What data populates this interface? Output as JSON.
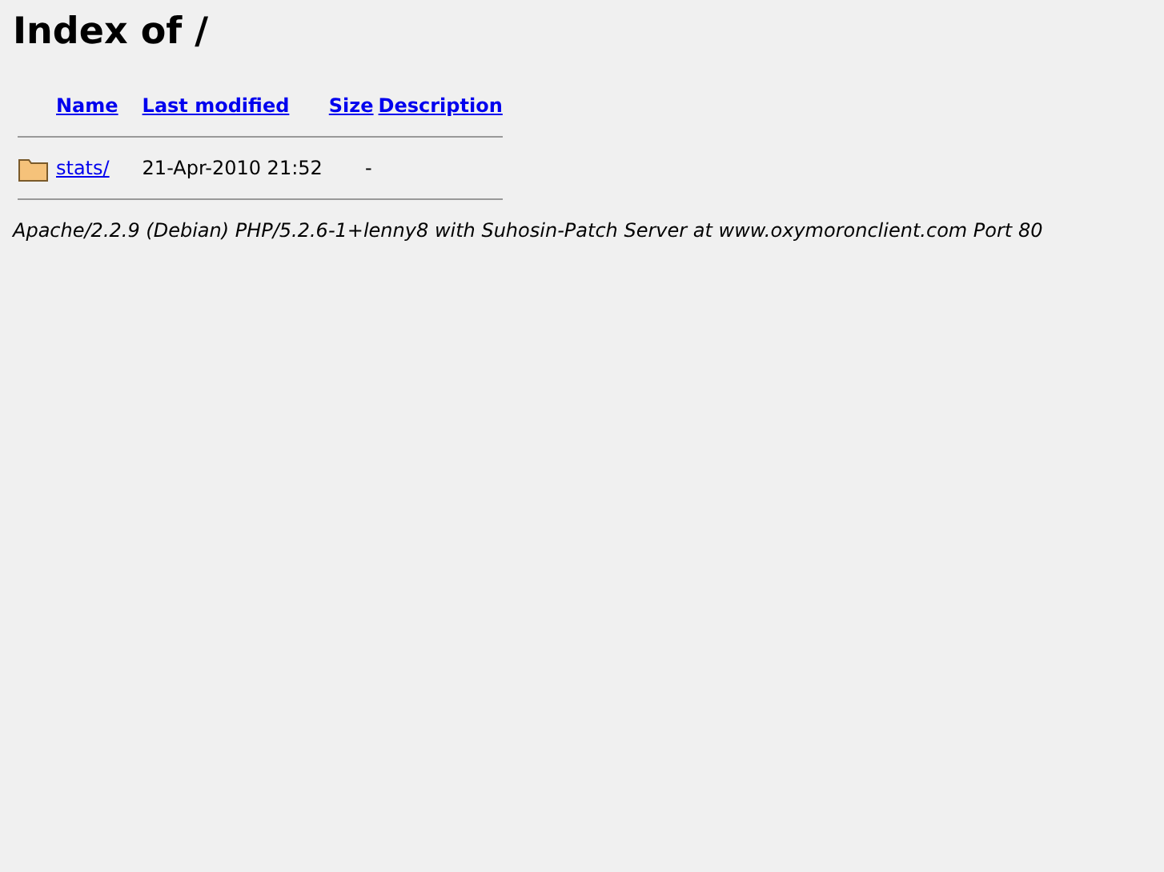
{
  "title": "Index of /",
  "columns": [
    "Name",
    "Last modified",
    "Size",
    "Description"
  ],
  "rows": [
    {
      "kind": "folder",
      "name": "stats/",
      "modified": "21-Apr-2010 21:52",
      "size": "-"
    }
  ],
  "address": "Apache/2.2.9 (Debian) PHP/5.2.6-1+lenny8 with Suhosin-Patch Server at www.oxymoronclient.com Port 80"
}
